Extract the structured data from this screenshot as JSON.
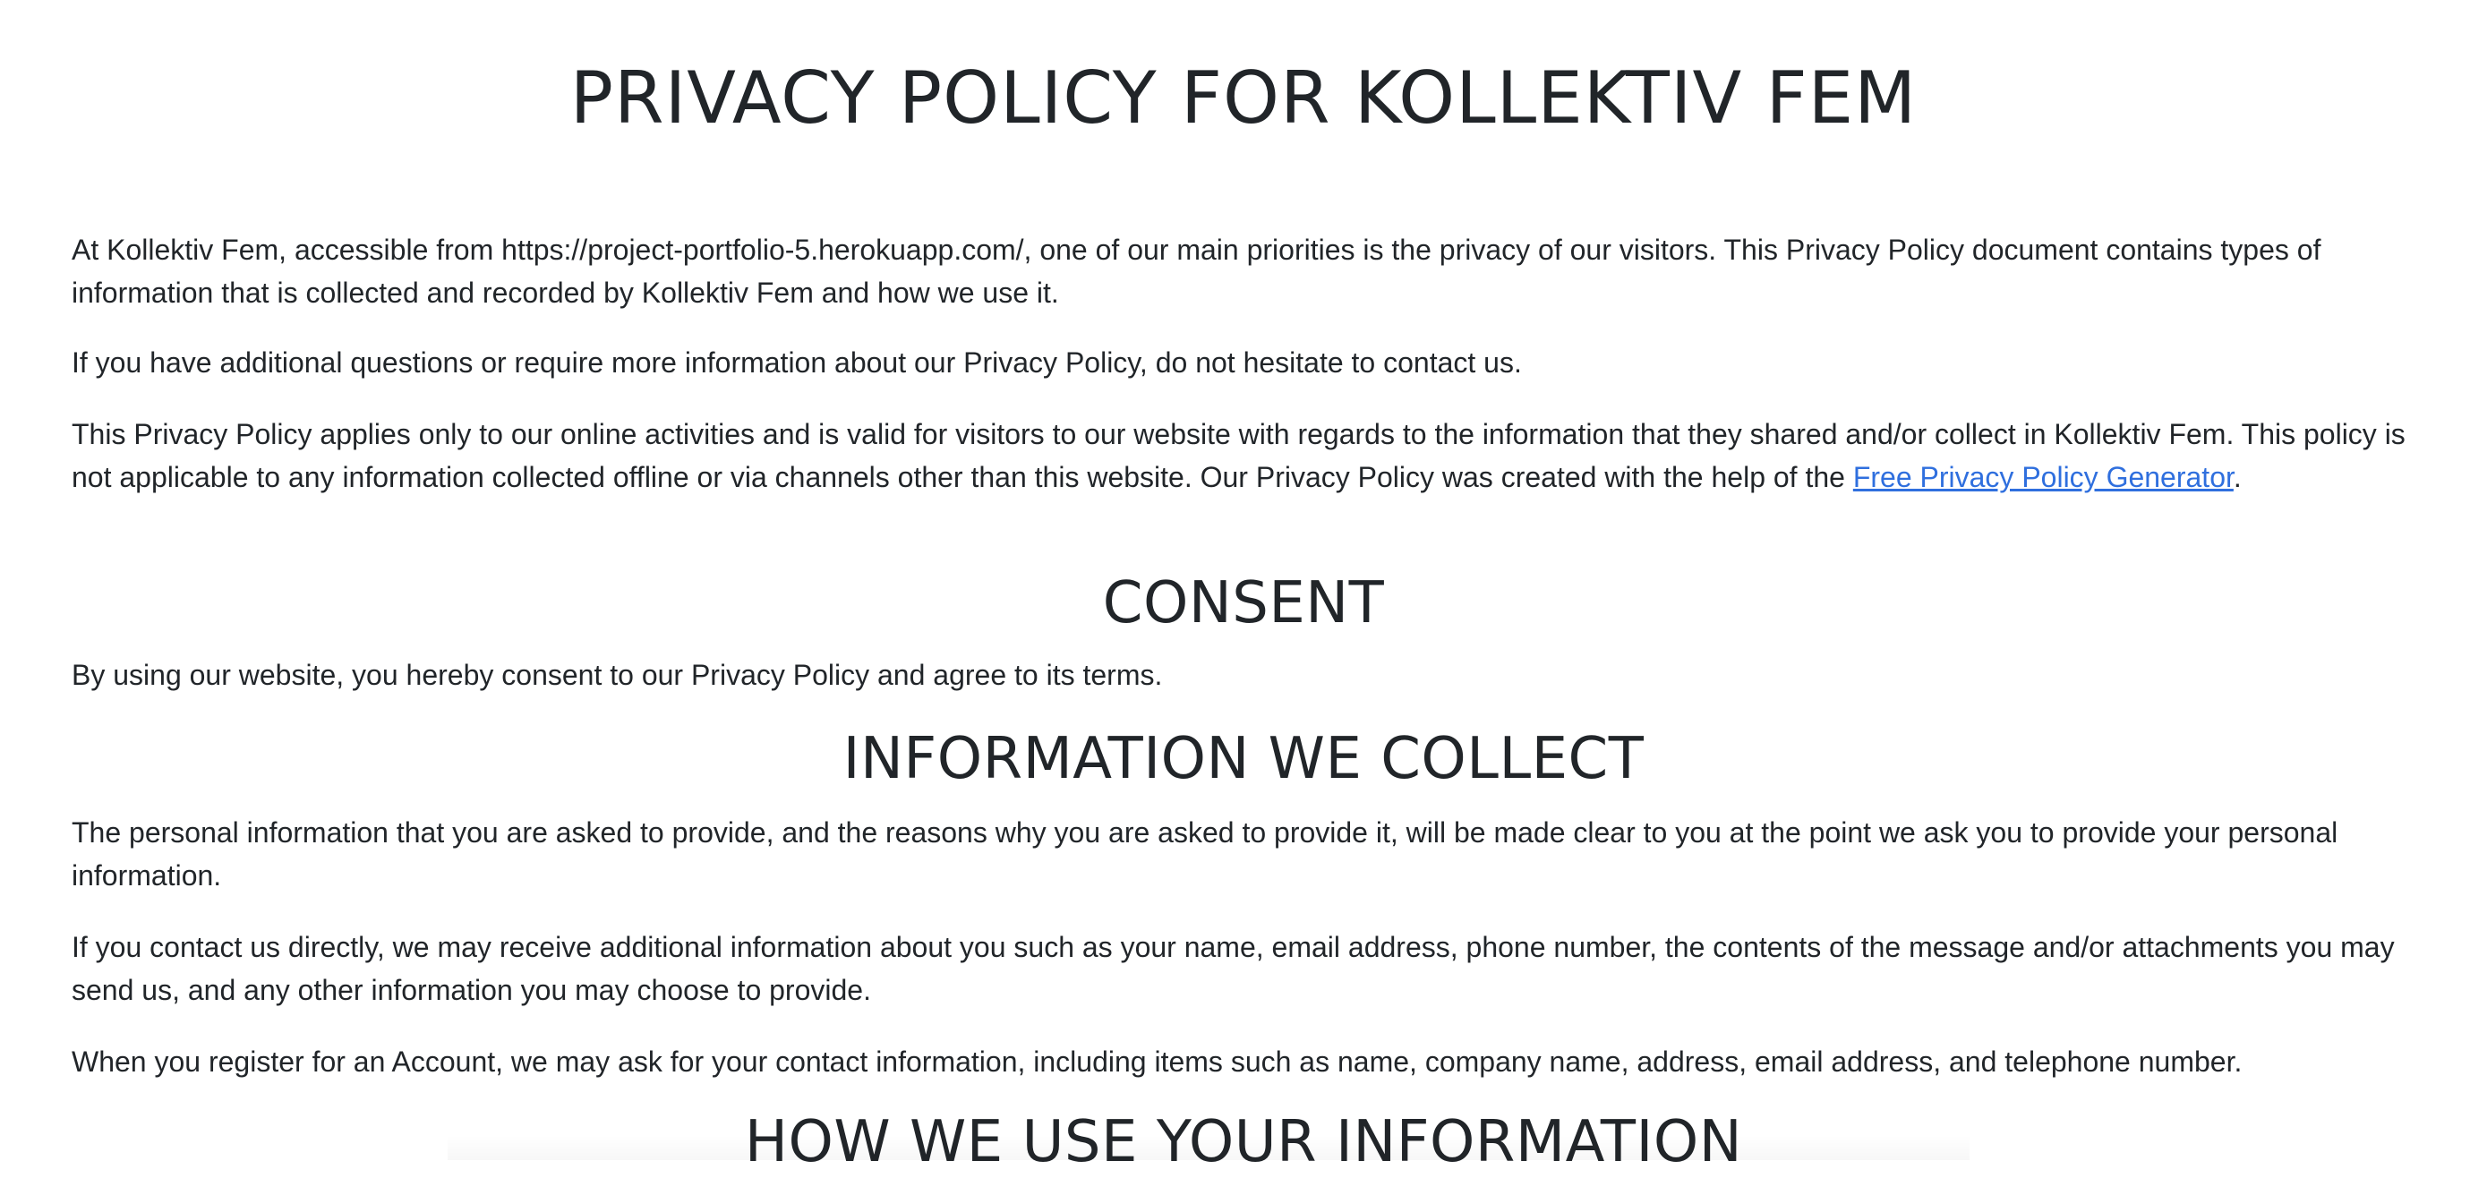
{
  "title": "PRIVACY POLICY FOR KOLLEKTIV FEM",
  "intro": {
    "p1": "At Kollektiv Fem, accessible from https://project-portfolio-5.herokuapp.com/, one of our main priorities is the privacy of our visitors. This Privacy Policy document contains types of information that is collected and recorded by Kollektiv Fem and how we use it.",
    "p2": "If you have additional questions or require more information about our Privacy Policy, do not hesitate to contact us.",
    "p3_before_link": "This Privacy Policy applies only to our online activities and is valid for visitors to our website with regards to the information that they shared and/or collect in Kollektiv Fem. This policy is not applicable to any information collected offline or via channels other than this website. Our Privacy Policy was created with the help of the ",
    "p3_link": "Free Privacy Policy Generator",
    "p3_after_link": "."
  },
  "consent": {
    "heading": "CONSENT",
    "p1": "By using our website, you hereby consent to our Privacy Policy and agree to its terms."
  },
  "collect": {
    "heading": "INFORMATION WE COLLECT",
    "p1": "The personal information that you are asked to provide, and the reasons why you are asked to provide it, will be made clear to you at the point we ask you to provide your personal information.",
    "p2": "If you contact us directly, we may receive additional information about you such as your name, email address, phone number, the contents of the message and/or attachments you may send us, and any other information you may choose to provide.",
    "p3": "When you register for an Account, we may ask for your contact information, including items such as name, company name, address, email address, and telephone number."
  },
  "usage": {
    "heading": "HOW WE USE YOUR INFORMATION"
  },
  "colors": {
    "text": "#212529",
    "link": "#2f6fde",
    "background": "#ffffff"
  }
}
